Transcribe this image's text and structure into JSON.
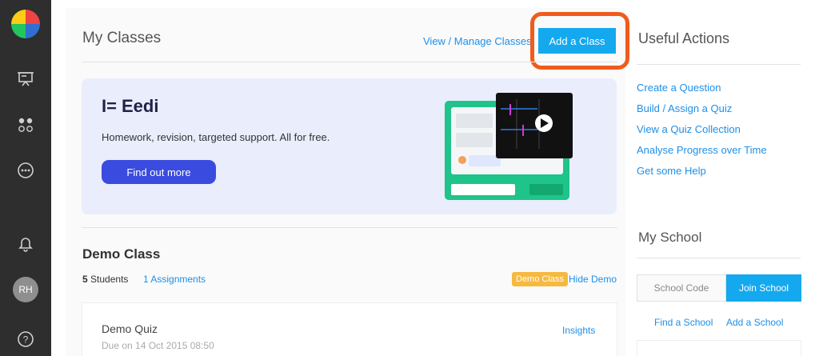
{
  "sidebar": {
    "avatar_initials": "RH",
    "items": [
      {
        "icon": "presentation-icon"
      },
      {
        "icon": "apps-grid-icon"
      },
      {
        "icon": "more-icon"
      },
      {
        "icon": "bell-icon"
      },
      {
        "icon": "help-icon"
      }
    ]
  },
  "header": {
    "title": "My Classes",
    "view_manage": "View / Manage Classes",
    "add_class": "Add a Class"
  },
  "banner": {
    "brand": "Eedi",
    "tagline": "Homework, revision, targeted support. All for free.",
    "cta": "Find out more"
  },
  "demo_class": {
    "title": "Demo Class",
    "students_count": "5",
    "students_label": "Students",
    "assignments": "1 Assignments",
    "badge": "Demo Class",
    "hide": "Hide Demo",
    "quiz": {
      "name": "Demo Quiz",
      "due": "Due on 14 Oct 2015 08:50",
      "insights": "Insights"
    }
  },
  "useful_actions": {
    "title": "Useful Actions",
    "links": [
      "Create a Question",
      "Build / Assign a Quiz",
      "View a Quiz Collection",
      "Analyse Progress over Time",
      "Get some Help"
    ]
  },
  "my_school": {
    "title": "My School",
    "school_code": "School Code",
    "join": "Join School",
    "find": "Find a School",
    "add": "Add a School"
  },
  "colors": {
    "accent": "#14a9ef",
    "link": "#1e8fe8",
    "highlight": "#f05b1c",
    "banner_bg": "#eaedfb",
    "cta": "#3a4be0",
    "badge": "#f6b940",
    "sidebar": "#2e2e2e"
  }
}
